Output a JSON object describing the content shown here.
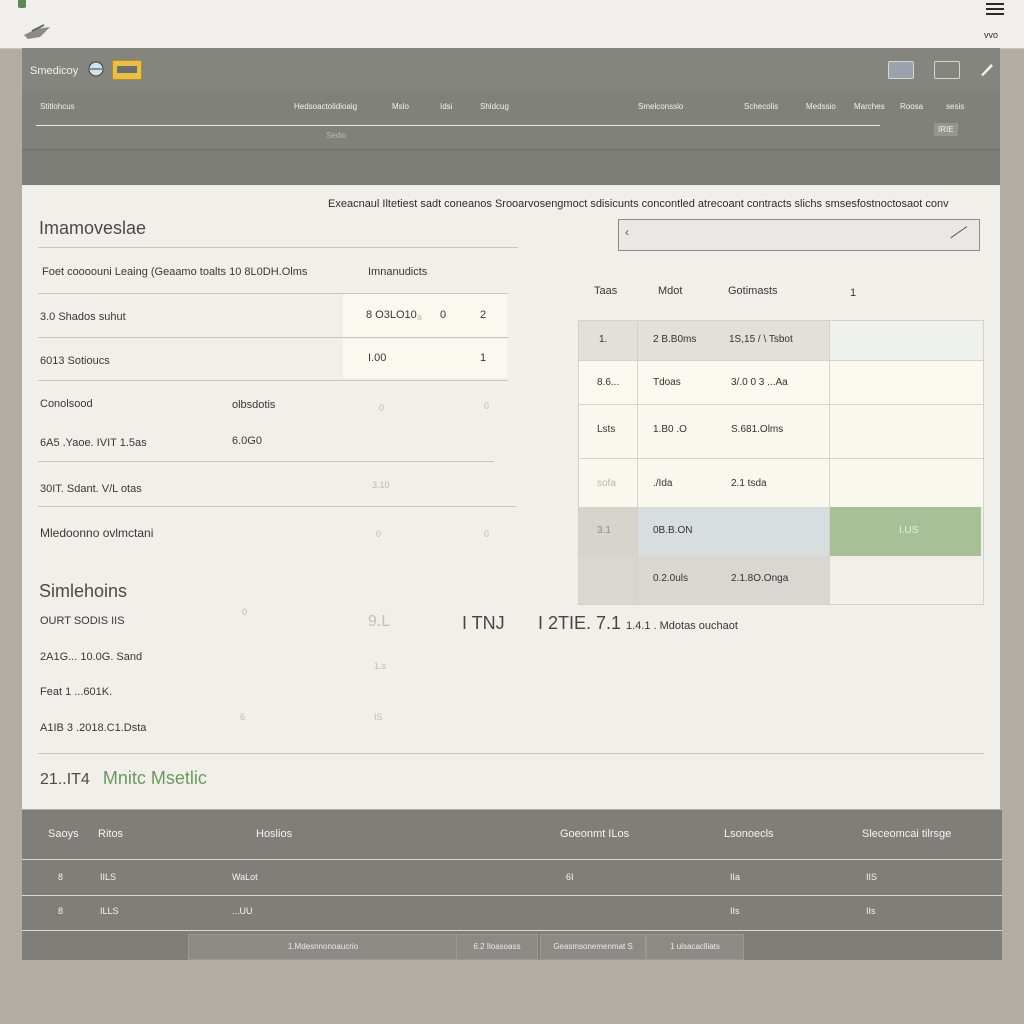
{
  "window": {
    "title": "Smedicoy",
    "right_tag": "vvo"
  },
  "toolbar": {
    "brand": "Smedicoy"
  },
  "columns": [
    "Stitlohcus",
    "Hedsoactolidioalg",
    "Mslo",
    "Idsi",
    "Shldcug",
    "Smelconsslo",
    "Schecolis",
    "Medssio",
    "Marches",
    "Roosa",
    "sesis"
  ],
  "subcol": "Sedio",
  "bar_right": "IRIE",
  "header_line": "Exeacnaul Iltetiest sadt coneanos Srooarvosengmoct sdisicunts concontled atrecoant contracts slichs smsesfostnoctosaot conv",
  "section1": {
    "title": "Imamoveslae",
    "subtitle_left": "Foet coooouni Leaing (Geaamo toalts 10 8L0DH.Olms",
    "subtitle_right": "Imnanudicts",
    "rows": [
      {
        "label": "3.0 Shados suhut",
        "v1": "8 O3LO10",
        "v2": "a",
        "v3": "0",
        "v4": "2"
      },
      {
        "label": "6013 Sotioucs",
        "v1": "I.00",
        "v4": "1"
      },
      {
        "label": "Conolsood",
        "mid": "olbsdotis",
        "f1": "0",
        "f2": "0"
      },
      {
        "label": "6A5 .Yaoe. IVIT 1.5as",
        "mid": "6.0G0"
      },
      {
        "label": "30IT. Sdant. V/L otas",
        "f1": "3.10"
      },
      {
        "label": "Mledoonno ovlmctani",
        "f1": "0",
        "f2": "0"
      }
    ]
  },
  "dropdown": {
    "value": ""
  },
  "grid": {
    "headers": [
      "Taas",
      "Mdot",
      "Gotimasts",
      "1"
    ],
    "rows": [
      [
        "1.",
        "2 B.B0ms",
        "1S,15 / \\ Tsbot"
      ],
      [
        "8.6...",
        "Tdoas",
        "3/.0 0 3 ...Aa"
      ],
      [
        "Lsts",
        "1.B0 .O",
        "S.681.Olms"
      ],
      [
        "sofa",
        "./Ida",
        "2.1 tsda"
      ],
      [
        "3.1",
        "0B.B.ON",
        ""
      ],
      [
        "",
        "0.2.0uls",
        "2.1.8O.Onga"
      ]
    ],
    "highlight_value": "I.US"
  },
  "section2": {
    "title": "Simlehoins",
    "rows": [
      {
        "label": "OURT SODIS IIS",
        "f1": "0",
        "n1": "9.L"
      },
      {
        "label": "2A1G... 10.0G. Sand",
        "f1": "1.s"
      },
      {
        "label": "Feat 1 ...601K."
      },
      {
        "label": "A1IB 3 .2018.C1.Dsta",
        "f1": "6",
        "f2": "IS"
      }
    ],
    "big": [
      "I TNJ",
      "I 2TIE. 7.1"
    ],
    "note": "1.4.1 .  Mdotas ouchaot"
  },
  "metric": {
    "value": "21..IT4",
    "label": "Mnitc Msetlic"
  },
  "footer": {
    "headers": [
      "Saoys",
      "Ritos",
      "Hoslios",
      "Goeonmt ILos",
      "Lsonoecls",
      "Sleceomcai tilrsge"
    ],
    "rows": [
      [
        "8",
        "IILS",
        "WaLot",
        "6I",
        "IIa",
        "IIS"
      ],
      [
        "8",
        "ILLS",
        "...UU",
        "",
        "IIs",
        "IIs"
      ]
    ],
    "pager": [
      "1.Mdesnnonoaucrio",
      "6.2 Iloasoass",
      "Geasmsonemenmat S",
      "1 ulsacaclliats"
    ]
  }
}
